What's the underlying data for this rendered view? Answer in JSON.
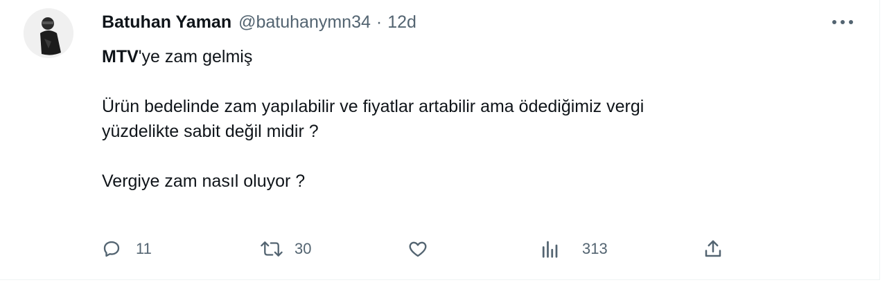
{
  "tweet": {
    "author_name": "Batuhan Yaman",
    "handle": "@batuhanymn34",
    "separator": "·",
    "time": "12d",
    "text_bold": "MTV",
    "text_line1_rest": "'ye zam gelmiş",
    "text_para2_line1": "Ürün bedelinde zam yapılabilir ve fiyatlar artabilir ama ödediğimiz vergi",
    "text_para2_line2": "yüzdelikte sabit değil midir ?",
    "text_para3": "Vergiye zam nasıl oluyor ?"
  },
  "actions": {
    "reply_count": "11",
    "retweet_count": "30",
    "like_count": "",
    "views_count": "313"
  },
  "icons": [
    "more-icon",
    "reply-icon",
    "retweet-icon",
    "like-icon",
    "views-icon",
    "share-icon"
  ],
  "colors": {
    "text": "#0f1419",
    "secondary": "#536471"
  }
}
